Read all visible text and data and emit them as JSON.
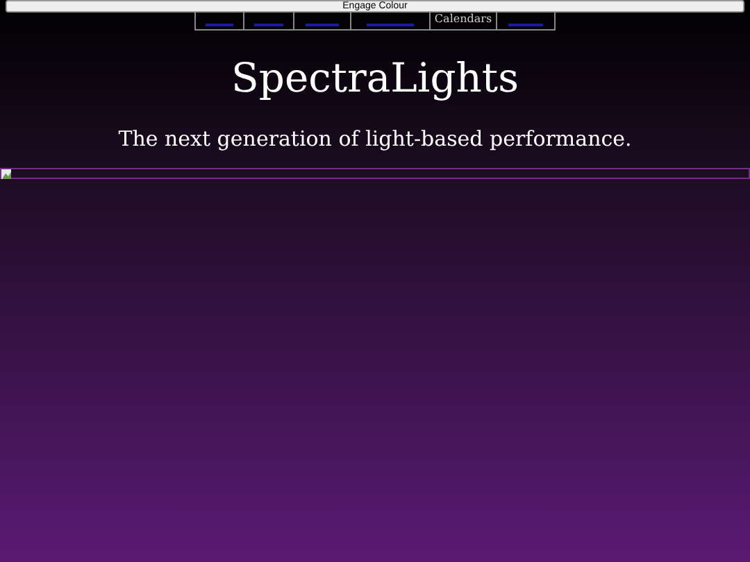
{
  "button": {
    "label": "Engage Colour"
  },
  "nav": [
    {
      "kind": "link"
    },
    {
      "kind": "link"
    },
    {
      "kind": "link"
    },
    {
      "kind": "link"
    },
    {
      "kind": "text",
      "label": "Calendars"
    },
    {
      "kind": "link"
    }
  ],
  "title": "SpectraLights",
  "tagline": "The next generation of light-based performance."
}
